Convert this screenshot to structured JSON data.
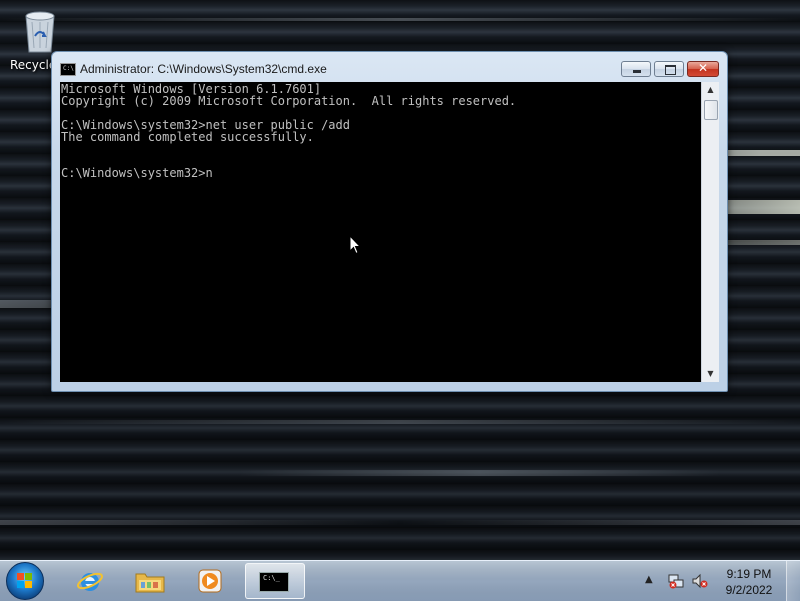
{
  "desktop": {
    "icons": [
      {
        "label": "Recycle"
      }
    ]
  },
  "window": {
    "title": "Administrator: C:\\Windows\\System32\\cmd.exe",
    "console_lines": [
      "Microsoft Windows [Version 6.1.7601]",
      "Copyright (c) 2009 Microsoft Corporation.  All rights reserved.",
      "",
      "C:\\Windows\\system32>net user public /add",
      "The command completed successfully.",
      "",
      "",
      "C:\\Windows\\system32>n"
    ],
    "colors": {
      "console_bg": "#000000",
      "console_fg": "#c0c0c0"
    }
  },
  "taskbar": {
    "pinned": [
      {
        "name": "start-button",
        "icon": "windows-flag-icon"
      },
      {
        "name": "internet-explorer",
        "icon": "ie-icon"
      },
      {
        "name": "windows-explorer",
        "icon": "folder-icon"
      },
      {
        "name": "media-player",
        "icon": "media-player-icon"
      },
      {
        "name": "command-prompt",
        "icon": "cmd-icon",
        "active": true
      }
    ],
    "tray": {
      "time": "9:19 PM",
      "date": "9/2/2022"
    }
  }
}
